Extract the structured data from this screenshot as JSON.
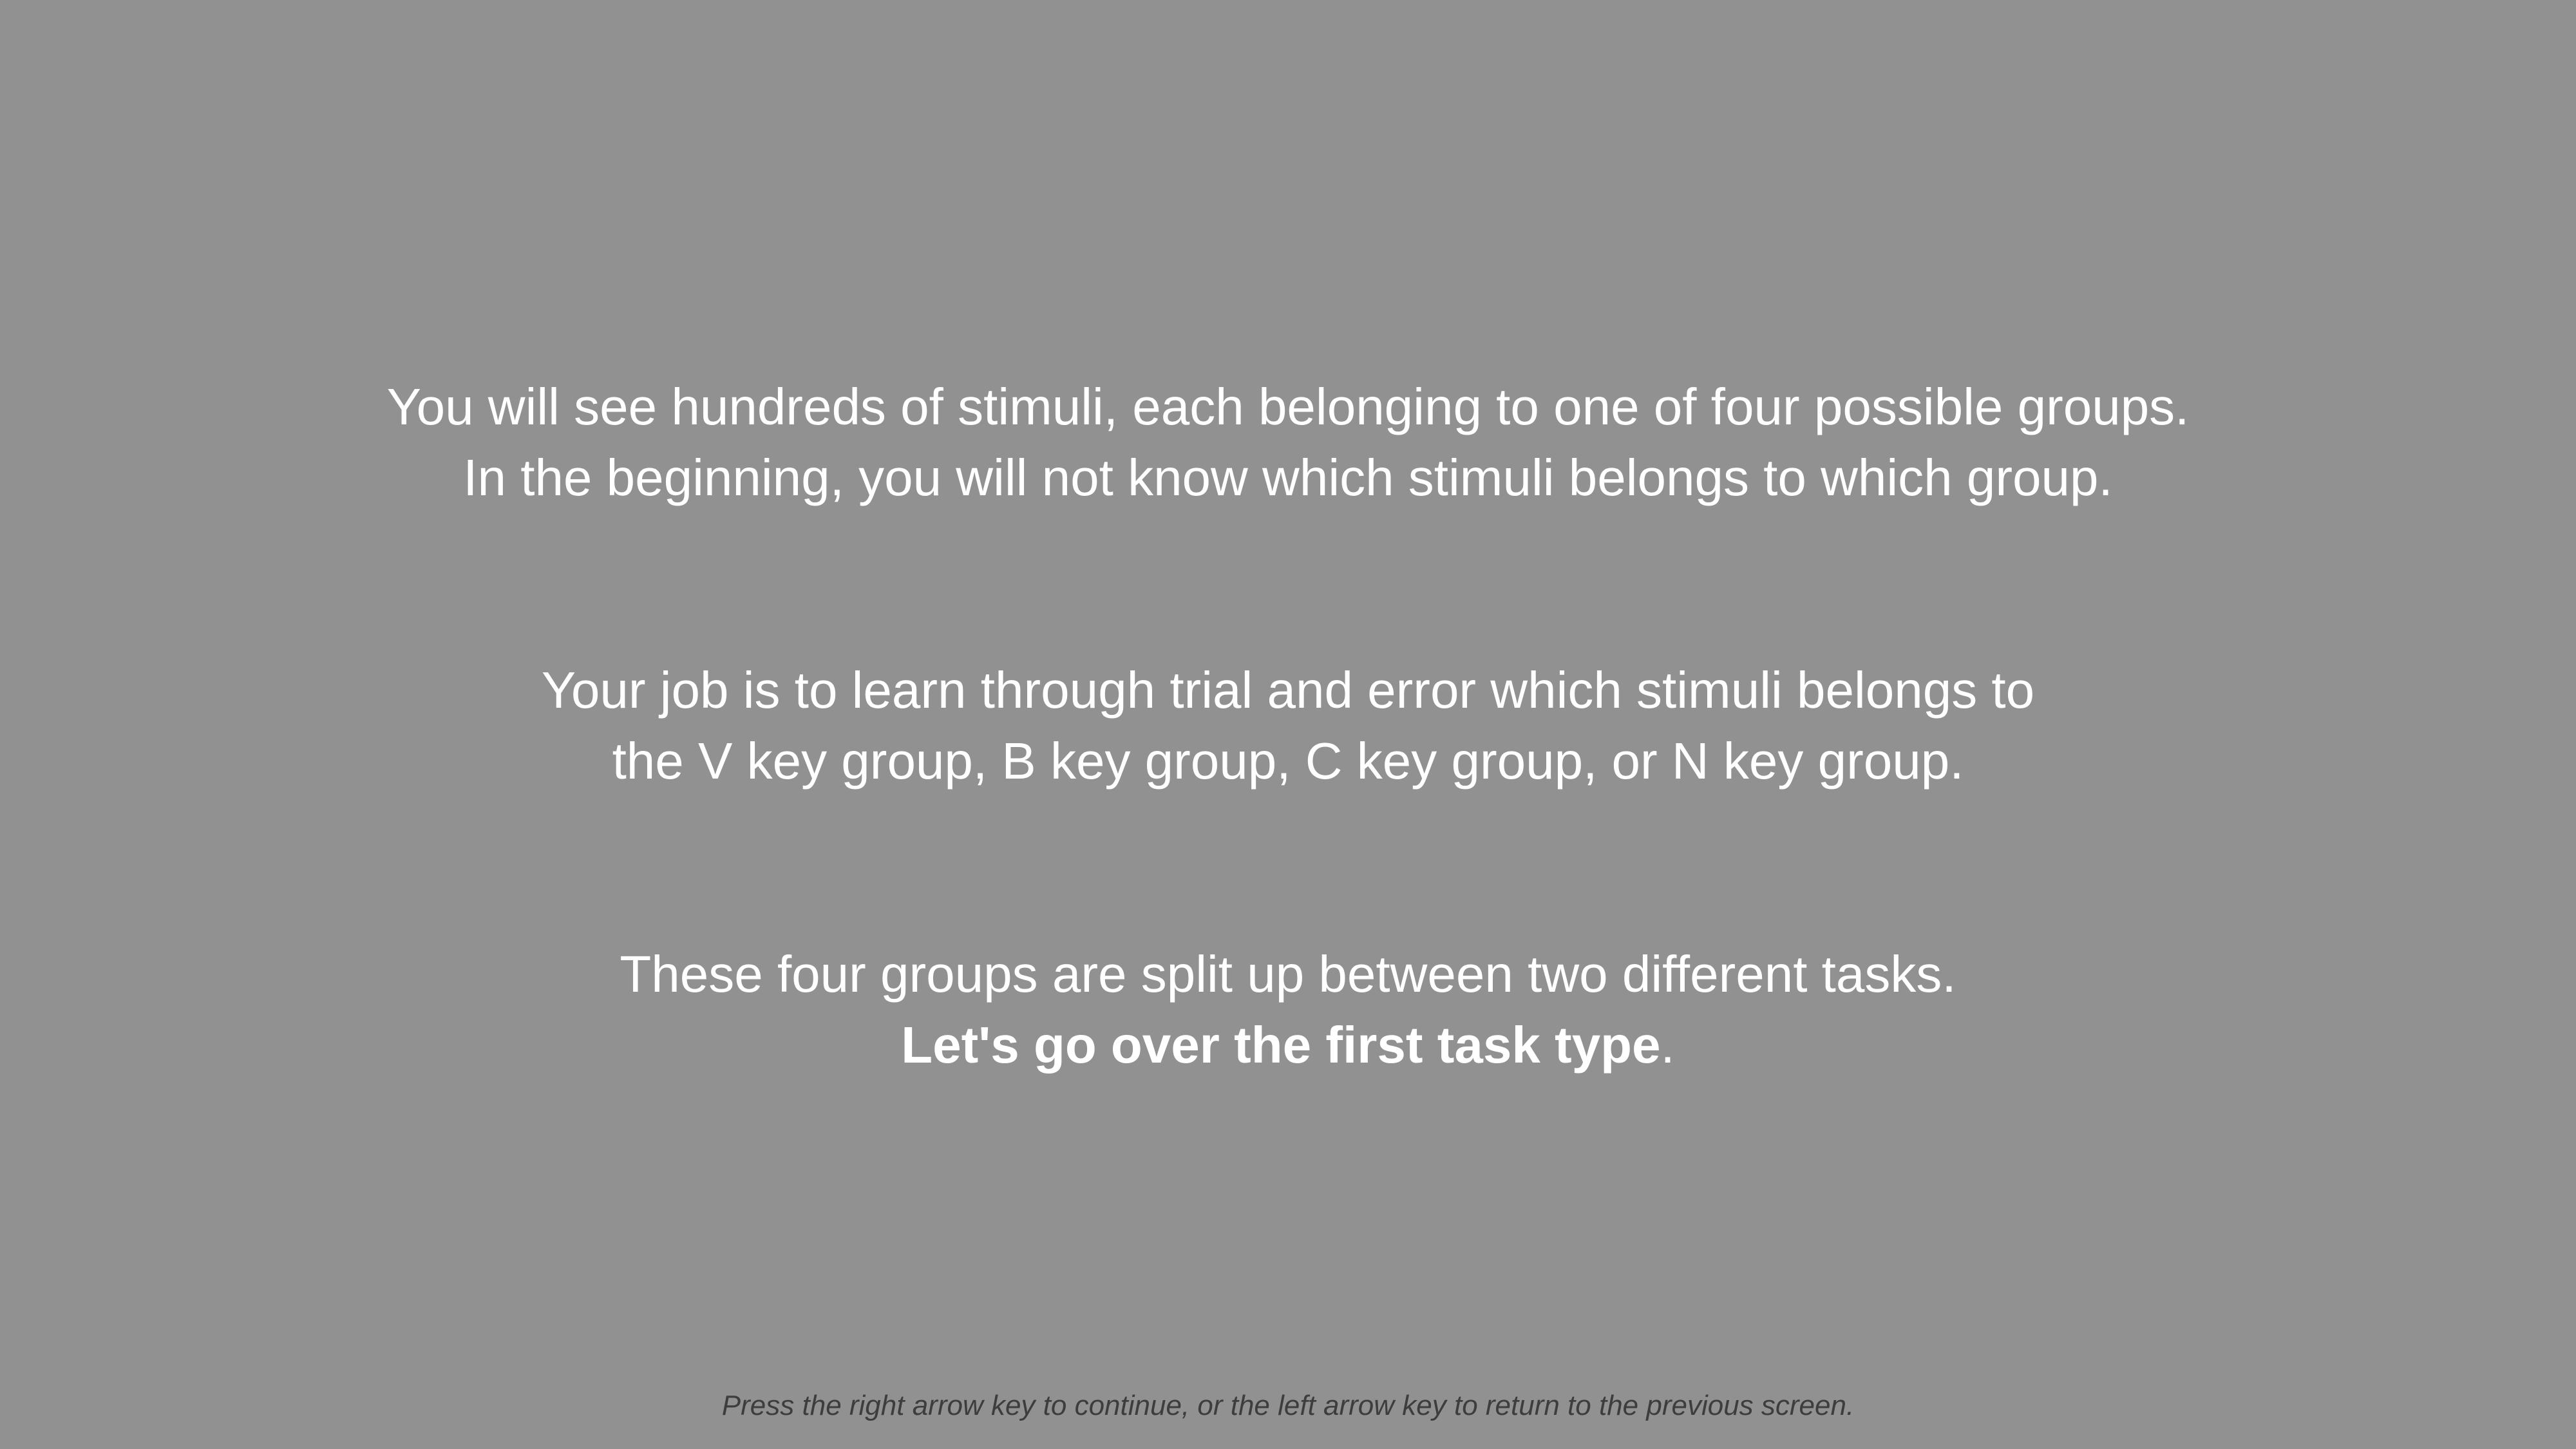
{
  "instructions": {
    "paragraph1": {
      "line1": "You will see hundreds of stimuli, each belonging to one of four possible groups.",
      "line2": "In the beginning, you will not know which stimuli belongs to which group."
    },
    "paragraph2": {
      "line1": "Your job is to learn through trial and error which stimuli belongs to",
      "line2": "the V key group, B key group, C key group, or N key group."
    },
    "paragraph3": {
      "line1": "These four groups are split up between two different tasks.",
      "line2_bold": "Let's go over the first task type",
      "line2_tail": "."
    }
  },
  "footer": {
    "navigation_hint": "Press the right arrow key to continue, or the left arrow key to return to the previous screen."
  },
  "colors": {
    "background": "#919191",
    "text": "#ffffff",
    "footer_text": "#3d3d3d"
  }
}
